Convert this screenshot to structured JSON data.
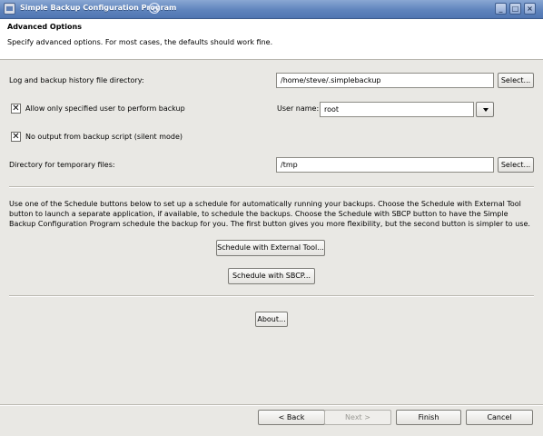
{
  "window": {
    "title": "Simple Backup Configuration Program"
  },
  "header": {
    "title": "Advanced Options",
    "description": "Specify advanced options. For most cases, the defaults should work fine."
  },
  "log_dir": {
    "label": "Log and backup history file directory:",
    "value": "/home/steve/.simplebackup",
    "button": "Select..."
  },
  "user_option": {
    "checkbox_label": "Allow only specified user to perform backup",
    "checked": true,
    "user_label": "User name:",
    "user_value": "root"
  },
  "silent_option": {
    "checkbox_label": "No output from backup script (silent mode)",
    "checked": true
  },
  "temp_dir": {
    "label": "Directory for temporary files:",
    "value": "/tmp",
    "button": "Select..."
  },
  "schedule": {
    "description": "Use one of the Schedule buttons below to set up a schedule for automatically running your backups. Choose the Schedule with External Tool button to launch a separate application, if available, to schedule the backups. Choose the Schedule with SBCP button to have the Simple Backup Configuration Program schedule the backup for you. The first button gives you more flexibility, but the second button is simpler to use.",
    "external_button": "Schedule with External Tool...",
    "sbcp_button": "Schedule with SBCP..."
  },
  "about_button": "About...",
  "footer": {
    "back": "< Back",
    "next": "Next >",
    "finish": "Finish",
    "cancel": "Cancel"
  }
}
